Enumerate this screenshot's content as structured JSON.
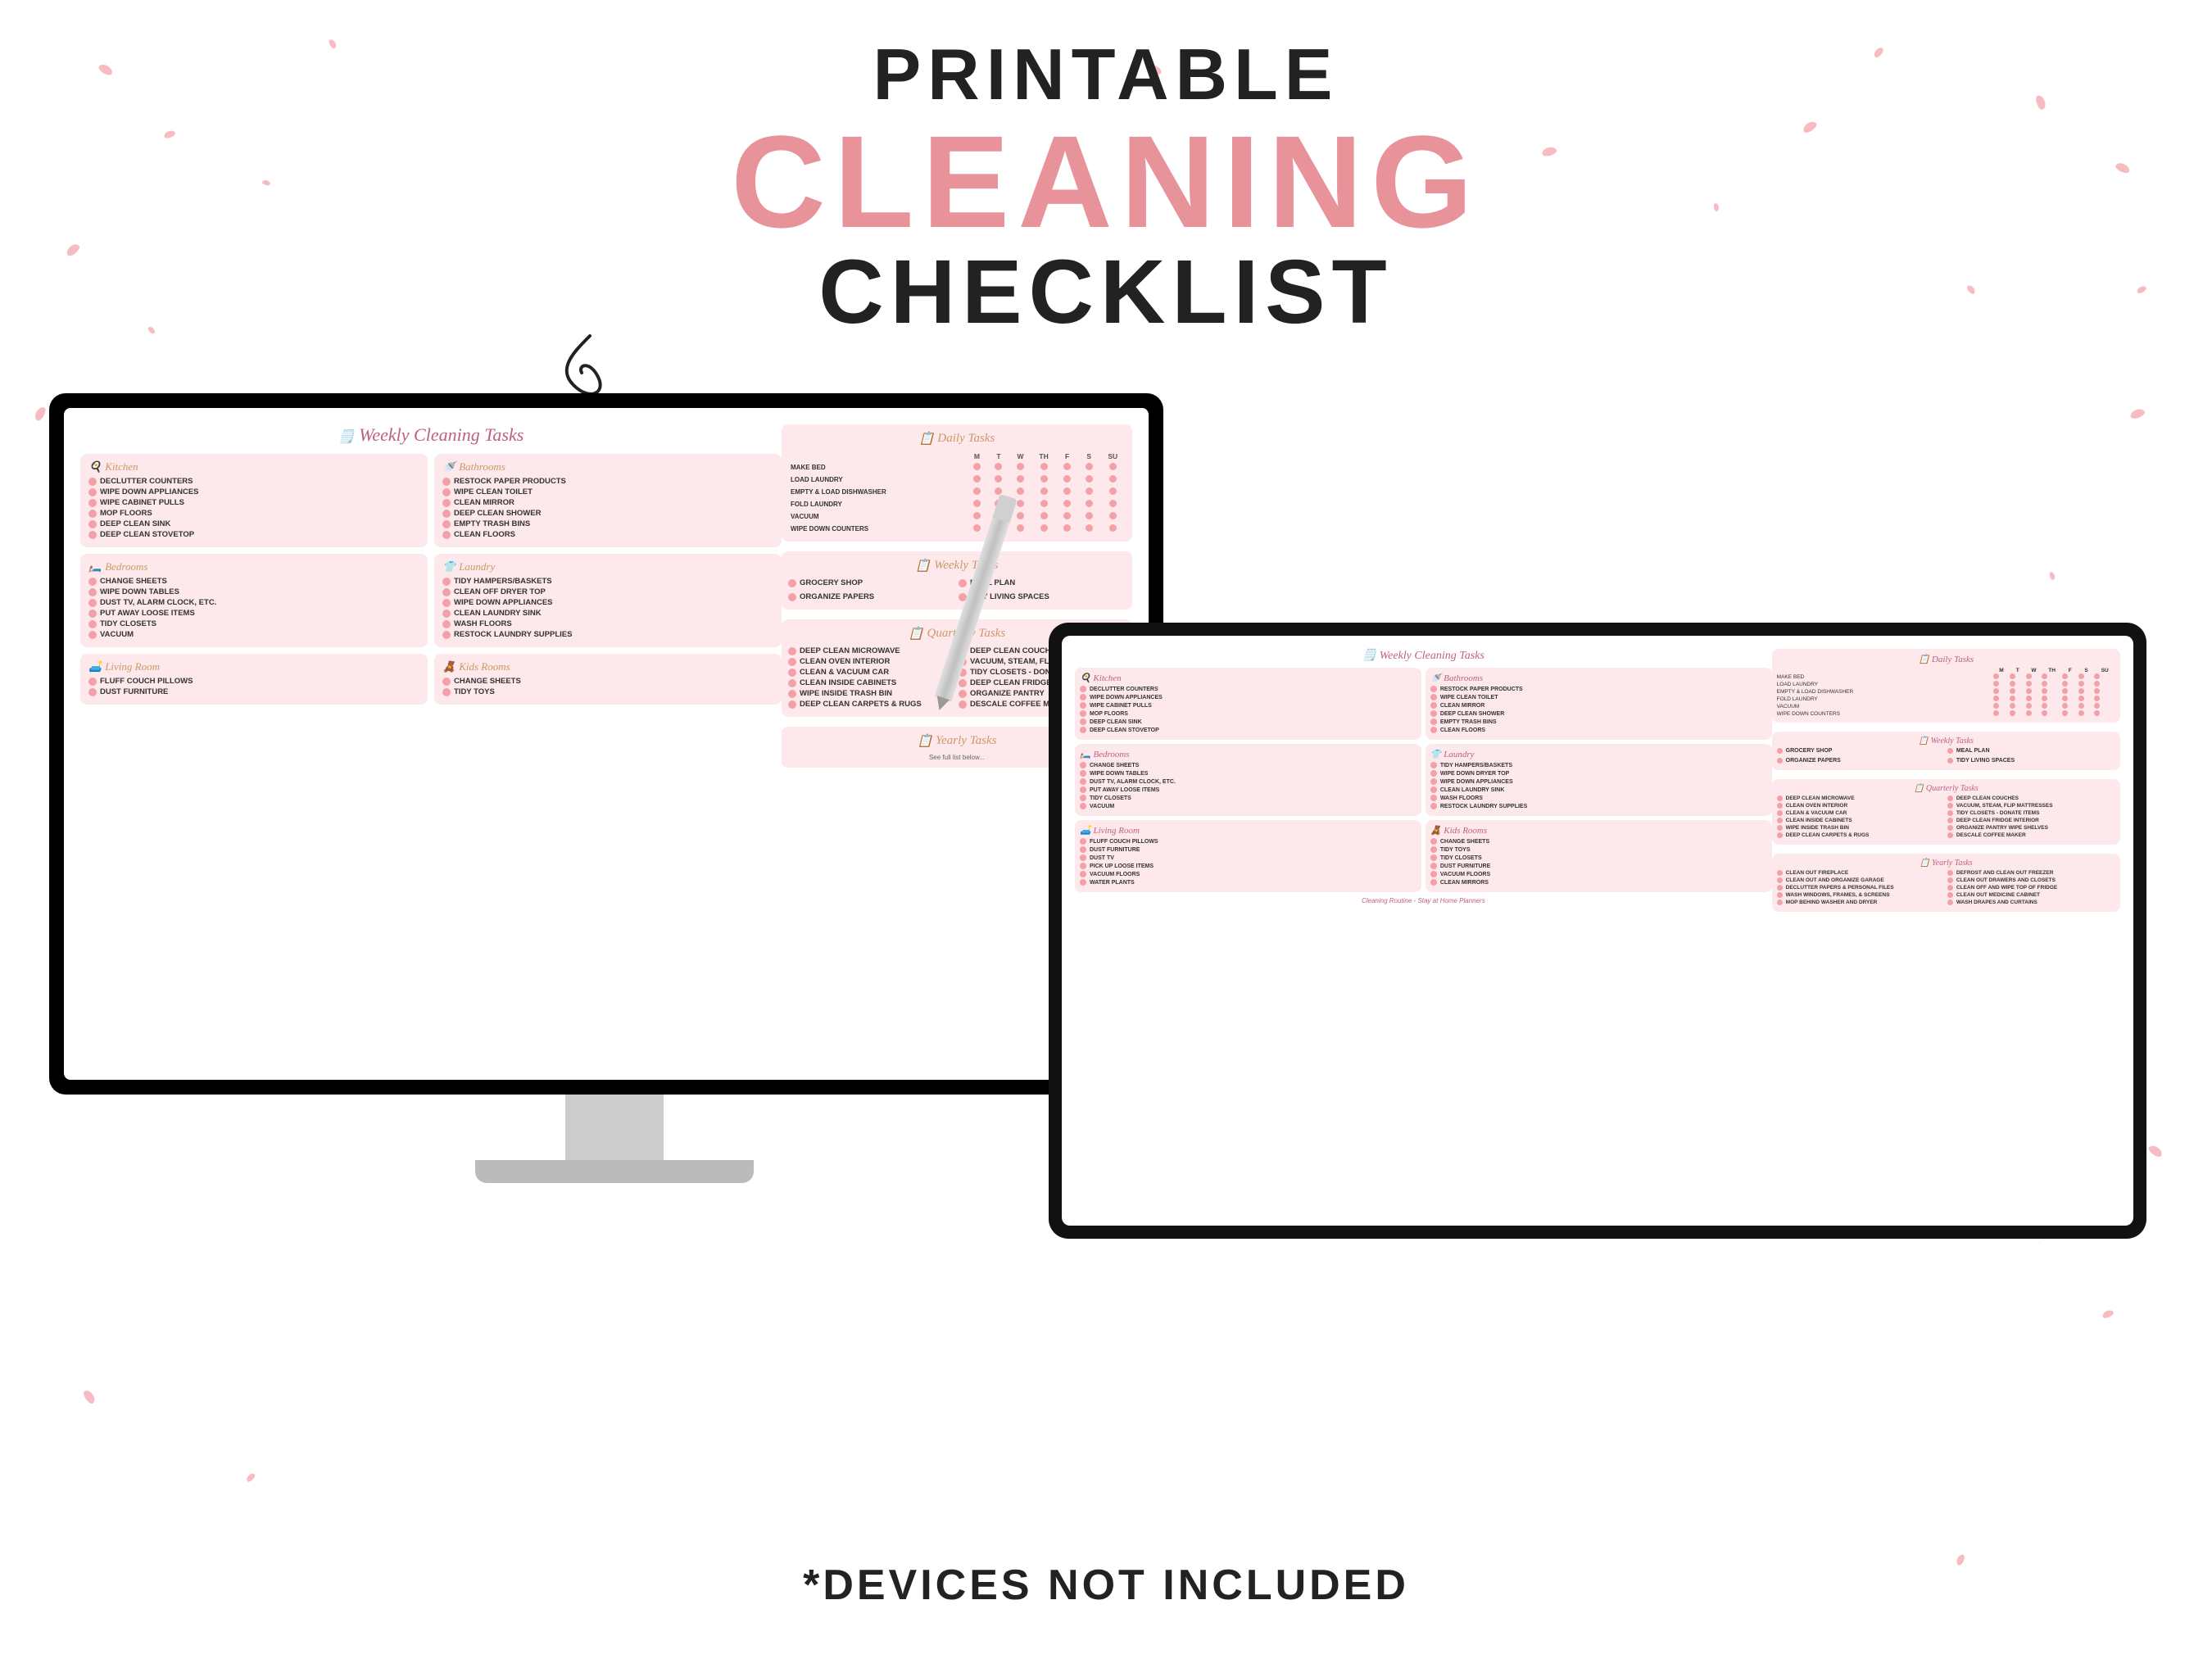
{
  "header": {
    "line1": "PRINTABLE",
    "line2": "CLEANING",
    "line3": "CHECKLIST"
  },
  "footer": {
    "text": "*DEVICES NOT INCLUDED"
  },
  "document": {
    "title": "Weekly Cleaning Tasks",
    "daily_title": "Daily Tasks",
    "weekly_tasks_title": "Weekly Tasks",
    "quarterly_title": "Quarterly Tasks",
    "yearly_title": "Yearly Tasks",
    "kitchen": {
      "label": "Kitchen",
      "items": [
        "DECLUTTER COUNTERS",
        "WIPE DOWN APPLIANCES",
        "WIPE CABINET PULLS",
        "MOP FLOORS",
        "DEEP CLEAN SINK",
        "DEEP CLEAN STOVETOP"
      ]
    },
    "bathrooms_weekly": {
      "label": "Bathrooms",
      "items": [
        "RESTOCK PAPER PRODUCTS",
        "WIPE CLEAN TOILET",
        "CLEAN MIRROR",
        "DEEP CLEAN SHOWER",
        "EMPTY TRASH BINS",
        "CLEAN FLOORS"
      ]
    },
    "bedrooms": {
      "label": "Bedrooms",
      "items": [
        "CHANGE SHEETS",
        "WIPE DOWN TABLES",
        "DUST TV, ALARM CLOCK, ETC.",
        "PUT AWAY LOOSE ITEMS",
        "TIDY CLOSETS",
        "VACUUM"
      ]
    },
    "laundry": {
      "label": "Laundry",
      "items": [
        "TIDY HAMPERS/BASKETS",
        "CLEAN OFF DRYER TOP",
        "WIPE DOWN APPLIANCES",
        "CLEAN LAUNDRY SINK",
        "WASH FLOORS",
        "RESTOCK LAUNDRY SUPPLIES"
      ]
    },
    "living_room": {
      "label": "Living Room",
      "items": [
        "FLUFF COUCH PILLOWS",
        "DUST FURNITURE"
      ]
    },
    "kids_rooms": {
      "label": "Kids Rooms",
      "items": [
        "CHANGE SHEETS",
        "TIDY TOYS"
      ]
    },
    "daily_tasks": {
      "rows": [
        "MAKE BED",
        "LOAD LAUNDRY",
        "EMPTY & LOAD DISHWASHER",
        "FOLD LAUNDRY",
        "VACUUM",
        "WIPE DOWN COUNTERS"
      ],
      "days": [
        "M",
        "T",
        "W",
        "TH",
        "F",
        "S",
        "SU"
      ]
    },
    "weekly_tasks": {
      "items": [
        "GROCERY SHOP",
        "ORGANIZE PAPERS",
        "MEAL PLAN",
        "TIDY LIVING SPACES"
      ]
    },
    "quarterly_tasks": {
      "col1": [
        "DEEP CLEAN MICROWAVE",
        "CLEAN OVEN INTERIOR",
        "CLEAN & VACUUM CAR",
        "CLEAN INSIDE CABINETS",
        "WIPE INSIDE TRASH BIN",
        "DEEP CLEAN CARPETS & RUGS"
      ],
      "col2": [
        "DEEP CLEAN COUCH",
        "VACUUM, STEAM, FLIP MATTRESSES",
        "TIDY CLOSETS - DONATE ITEMS",
        "DEEP CLEAN FRIDGE INTERIOR",
        "ORGANIZE PANTRY WIPE SHELVES",
        "DESCALE COFFEE MAKER"
      ]
    },
    "yearly_tasks": {
      "col1": [
        "CLEAN OUT FIREPLACE",
        "CLEAN OUT AND ORGANIZE GARAGE",
        "DECLUTTER PAPERS & PERSONAL FILES",
        "WASH WINDOWS, FRAMES, & SCREENS",
        "MOP BEHIND WASHER AND DRYER"
      ],
      "col2": [
        "DEFROST AND CLEAN OUT FREEZER",
        "CLEAN OUT DRAWERS AND CLOSETS",
        "CLEAN OFF AND WIPE TOP OF FRIDGE",
        "CLEAN OUT MEDICINE CABINET",
        "WASH DRAPES AND CURTAINS"
      ]
    },
    "credit": "Cleaning Routine - Stay at Home Planners"
  }
}
